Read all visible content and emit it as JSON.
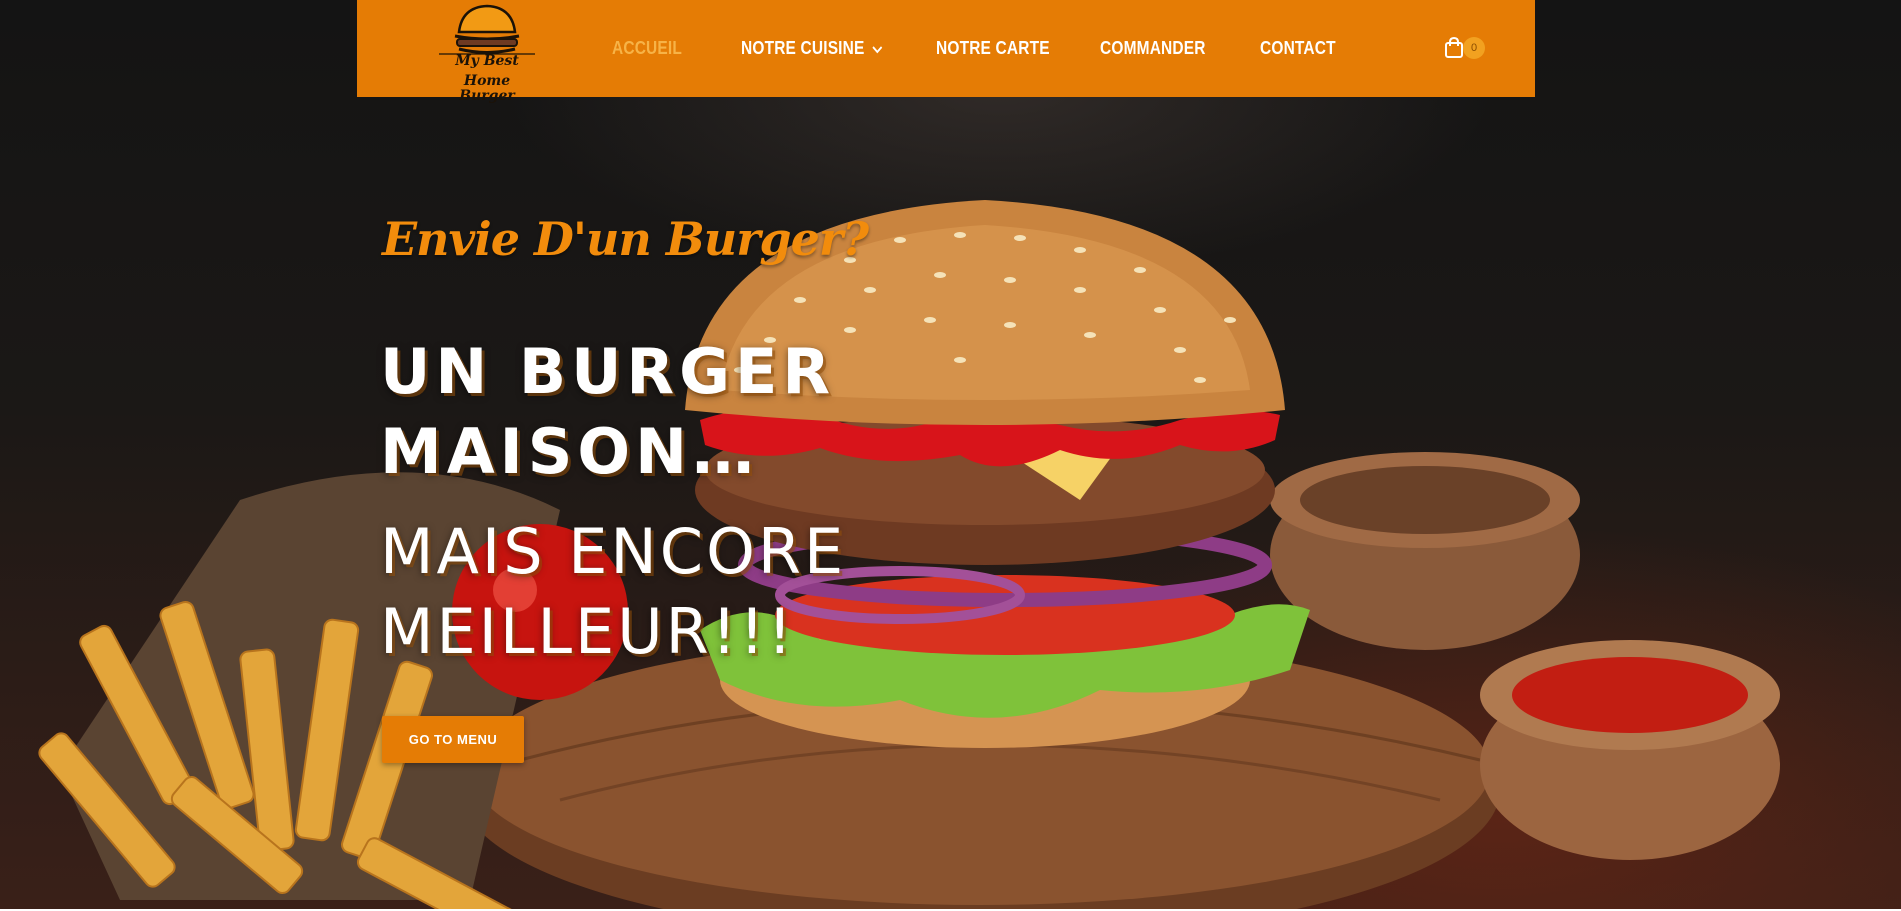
{
  "nav": {
    "logo": {
      "line1": "My Best",
      "line2": "Home Burger"
    },
    "items": [
      {
        "label": "ACCUEIL",
        "active": true
      },
      {
        "label": "NOTRE CUISINE",
        "has_dropdown": true
      },
      {
        "label": "NOTRE CARTE"
      },
      {
        "label": "COMMANDER"
      },
      {
        "label": "CONTACT"
      }
    ],
    "cart_count": "0"
  },
  "hero": {
    "tagline": "Envie D'un Burger?",
    "headline_line1": "UN BURGER",
    "headline_line2": "MAISON…",
    "subheadline_line1": "MAIS ENCORE",
    "subheadline_line2": "MEILLEUR!!!",
    "cta_label": "GO TO MENU"
  },
  "colors": {
    "accent": "#e57c05",
    "active_link": "#f7b347",
    "tagline": "#f28c0c"
  }
}
